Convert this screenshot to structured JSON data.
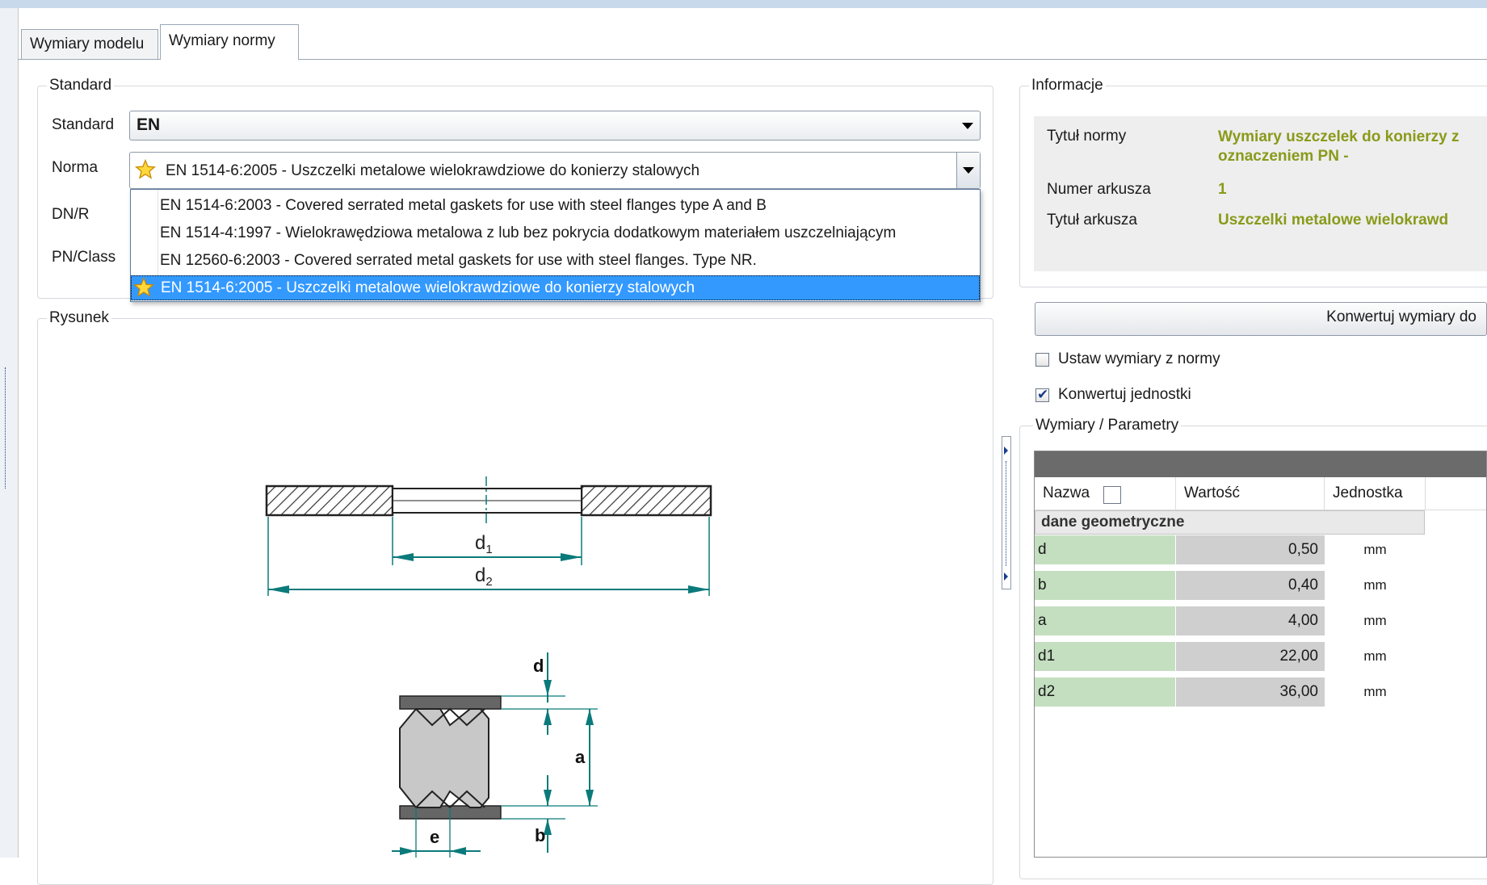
{
  "tabs": [
    {
      "label": "Wymiary modelu"
    },
    {
      "label": "Wymiary normy"
    }
  ],
  "standard_group": {
    "legend": "Standard",
    "standard_label": "Standard",
    "standard_value": "EN",
    "norma_label": "Norma",
    "norma_value": "EN 1514-6:2005 - Uszczelki metalowe wielokrawdziowe do konierzy stalowych",
    "dnr_label": "DN/R",
    "pnclass_label": "PN/Class",
    "norma_options": [
      {
        "label": "EN 1514-6:2003 - Covered serrated metal gaskets for use with steel flanges type A and B",
        "favorite": false,
        "selected": false
      },
      {
        "label": "EN 1514-4:1997 - Wielokrawędziowa metalowa z lub bez pokrycia dodatkowym materiałem uszczelniającym",
        "favorite": false,
        "selected": false
      },
      {
        "label": "EN 12560-6:2003 - Covered serrated metal gaskets for use with steel flanges. Type NR.",
        "favorite": false,
        "selected": false
      },
      {
        "label": "EN 1514-6:2005 - Uszczelki metalowe wielokrawdziowe do konierzy stalowych",
        "favorite": true,
        "selected": true
      }
    ]
  },
  "drawing_group": {
    "legend": "Rysunek",
    "labels": {
      "d1": "d",
      "d1_sub": "1",
      "d2": "d",
      "d2_sub": "2",
      "d": "d",
      "a": "a",
      "b": "b",
      "e": "e"
    }
  },
  "info_group": {
    "legend": "Informacje",
    "rows": [
      {
        "label": "Tytuł normy",
        "value": "Wymiary uszczelek do konierzy z oznaczeniem PN -"
      },
      {
        "label": "Numer arkusza",
        "value": "1"
      },
      {
        "label": "Tytuł arkusza",
        "value": "Uszczelki metalowe wielokrawd"
      }
    ]
  },
  "convert_button": "Konwertuj wymiary do",
  "checkboxes": [
    {
      "label": "Ustaw wymiary z normy",
      "checked": false
    },
    {
      "label": "Konwertuj jednostki",
      "checked": true
    }
  ],
  "params_group": {
    "legend": "Wymiary / Parametry",
    "columns": [
      "Nazwa",
      "Wartość",
      "Jednostka"
    ],
    "group_row": "dane geometryczne",
    "rows": [
      {
        "name": "d",
        "value": "0,50",
        "unit": "mm"
      },
      {
        "name": "b",
        "value": "0,40",
        "unit": "mm"
      },
      {
        "name": "a",
        "value": "4,00",
        "unit": "mm"
      },
      {
        "name": "d1",
        "value": "22,00",
        "unit": "mm"
      },
      {
        "name": "d2",
        "value": "36,00",
        "unit": "mm"
      }
    ]
  },
  "colors": {
    "accent": "#3399ff",
    "info_value": "#8a9a1a",
    "name_cell": "#c4dfc0",
    "value_cell": "#cfcfcf",
    "dimension": "#008080"
  }
}
